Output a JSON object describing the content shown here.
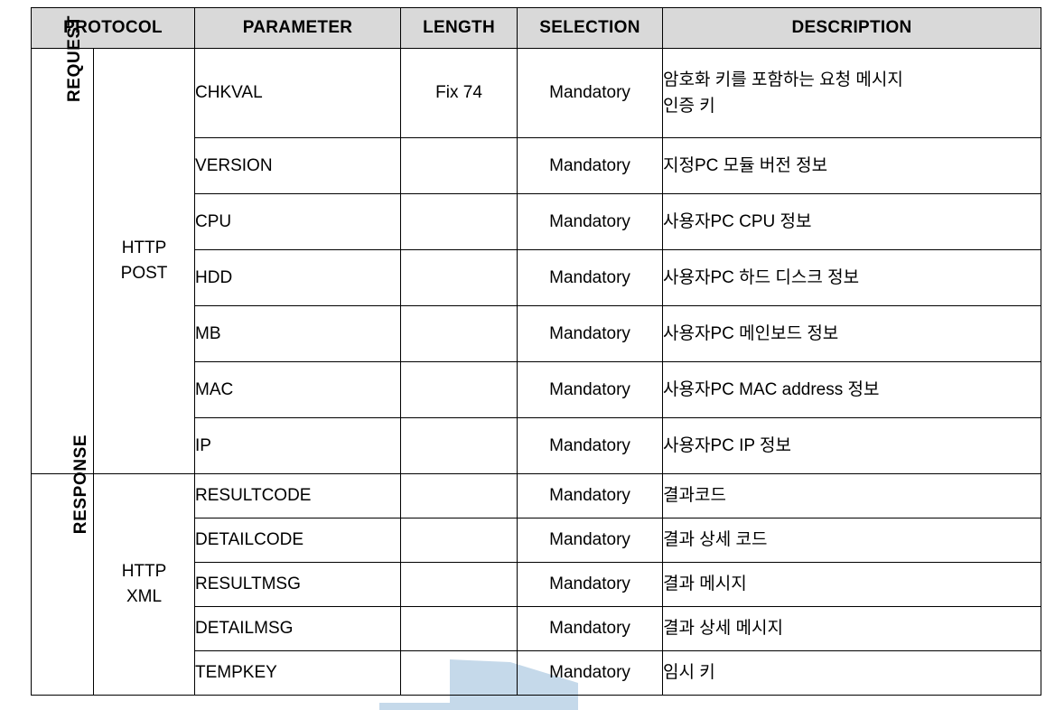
{
  "table": {
    "columns": [
      {
        "id": "protocol",
        "label": "PROTOCOL"
      },
      {
        "id": "parameter",
        "label": "PARAMETER"
      },
      {
        "id": "length",
        "label": "LENGTH"
      },
      {
        "id": "selection",
        "label": "SELECTION"
      },
      {
        "id": "description",
        "label": "DESCRIPTION"
      }
    ],
    "header_background": "#d9d9d9",
    "border_color": "#000000",
    "groups": [
      {
        "name": "REQUEST",
        "transport_lines": [
          "HTTP",
          "POST"
        ],
        "rows": [
          {
            "parameter": "CHKVAL",
            "length": "Fix  74",
            "selection": "Mandatory",
            "description_lines": [
              "암호화 키를 포함하는 요청 메시지",
              "인증 키"
            ]
          },
          {
            "parameter": "VERSION",
            "length": "",
            "selection": "Mandatory",
            "description_lines": [
              "지정PC 모듈 버전 정보"
            ]
          },
          {
            "parameter": "CPU",
            "length": "",
            "selection": "Mandatory",
            "description_lines": [
              "사용자PC CPU 정보"
            ]
          },
          {
            "parameter": "HDD",
            "length": "",
            "selection": "Mandatory",
            "description_lines": [
              "사용자PC 하드 디스크 정보"
            ]
          },
          {
            "parameter": "MB",
            "length": "",
            "selection": "Mandatory",
            "description_lines": [
              "사용자PC 메인보드 정보"
            ]
          },
          {
            "parameter": "MAC",
            "length": "",
            "selection": "Mandatory",
            "description_lines": [
              "사용자PC MAC address 정보"
            ]
          },
          {
            "parameter": "IP",
            "length": "",
            "selection": "Mandatory",
            "description_lines": [
              "사용자PC IP 정보"
            ]
          }
        ]
      },
      {
        "name": "RESPONSE",
        "transport_lines": [
          "HTTP",
          "XML"
        ],
        "rows": [
          {
            "parameter": "RESULTCODE",
            "length": "",
            "selection": "Mandatory",
            "description_lines": [
              "결과코드"
            ]
          },
          {
            "parameter": "DETAILCODE",
            "length": "",
            "selection": "Mandatory",
            "description_lines": [
              "결과 상세 코드"
            ]
          },
          {
            "parameter": "RESULTMSG",
            "length": "",
            "selection": "Mandatory",
            "description_lines": [
              "결과 메시지"
            ]
          },
          {
            "parameter": "DETAILMSG",
            "length": "",
            "selection": "Mandatory",
            "description_lines": [
              "결과 상세 메시지"
            ]
          },
          {
            "parameter": "TEMPKEY",
            "length": "",
            "selection": "Mandatory",
            "description_lines": [
              "임시 키"
            ]
          }
        ]
      }
    ]
  },
  "watermark": {
    "color": "#c5d9ea"
  }
}
